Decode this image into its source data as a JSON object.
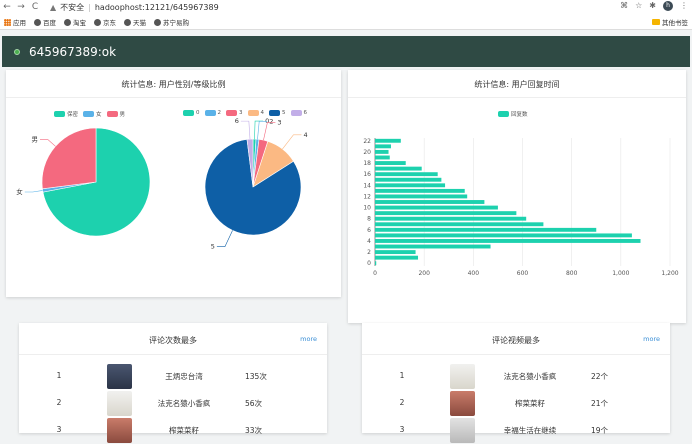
{
  "browser": {
    "url_warning": "不安全",
    "url": "hadoophost:12121/645967389",
    "avatar": "h",
    "bookmarks": [
      "应用",
      "百度",
      "淘宝",
      "京东",
      "天猫",
      "苏宁易购"
    ],
    "other_bookmarks": "其他书签"
  },
  "header": {
    "title": "645967389:ok",
    "accent": "#2f4a44"
  },
  "card1": {
    "title": "统计信息: 用户性别/等级比例",
    "gender_legend": [
      {
        "label": "保密",
        "color": "#1dd1ae"
      },
      {
        "label": "女",
        "color": "#5ab2e8"
      },
      {
        "label": "男",
        "color": "#f4697f"
      }
    ],
    "level_legend": [
      {
        "label": "0",
        "color": "#1dd1ae"
      },
      {
        "label": "2",
        "color": "#5ab2e8"
      },
      {
        "label": "3",
        "color": "#f4697f"
      },
      {
        "label": "4",
        "color": "#fbb983"
      },
      {
        "label": "5",
        "color": "#0e5fa6"
      },
      {
        "label": "6",
        "color": "#c2aee8"
      }
    ]
  },
  "card2": {
    "title": "统计信息: 用户回复时间",
    "legend": "回复数"
  },
  "chart_data": [
    {
      "type": "pie",
      "labels": [
        "保密",
        "女",
        "男"
      ],
      "values": [
        72,
        1,
        27
      ],
      "colors": [
        "#1dd1ae",
        "#5ab2e8",
        "#f4697f"
      ],
      "slice_labels": [
        "",
        "女",
        "男"
      ]
    },
    {
      "type": "pie",
      "labels": [
        "0",
        "2",
        "3",
        "4",
        "5",
        "6"
      ],
      "values": [
        1,
        1,
        3,
        11,
        82,
        2
      ],
      "colors": [
        "#1dd1ae",
        "#5ab2e8",
        "#f4697f",
        "#fbb983",
        "#0e5fa6",
        "#c2aee8"
      ],
      "slice_labels": [
        "0",
        "2",
        "3",
        "4",
        "5",
        "6"
      ]
    },
    {
      "type": "bar",
      "orientation": "horizontal",
      "series": [
        {
          "name": "回复数",
          "color": "#1dd1ae",
          "values": [
            5,
            175,
            165,
            470,
            1080,
            1045,
            900,
            685,
            615,
            575,
            500,
            445,
            375,
            365,
            285,
            270,
            255,
            190,
            125,
            60,
            55,
            65,
            105
          ]
        }
      ],
      "categories": [
        "0",
        "1",
        "2",
        "3",
        "4",
        "5",
        "6",
        "7",
        "8",
        "9",
        "10",
        "11",
        "12",
        "13",
        "14",
        "15",
        "16",
        "17",
        "18",
        "19",
        "20",
        "21",
        "22"
      ],
      "y_tick_labels": [
        "0",
        "2",
        "4",
        "6",
        "8",
        "10",
        "12",
        "14",
        "16",
        "18",
        "20",
        "22"
      ],
      "x_tick_labels": [
        "0",
        "200",
        "400",
        "600",
        "800",
        "1,000",
        "1,200"
      ],
      "xlim": [
        0,
        1200
      ],
      "grid": true
    }
  ],
  "table1": {
    "title": "评论次数最多",
    "more": "more",
    "rows": [
      {
        "rank": "1",
        "name": "王炳忠台湾",
        "count": "135次"
      },
      {
        "rank": "2",
        "name": "法克名猿小香疯",
        "count": "56次"
      },
      {
        "rank": "3",
        "name": "榨菜菜籽",
        "count": "33次"
      }
    ]
  },
  "table2": {
    "title": "评论视频最多",
    "more": "more",
    "rows": [
      {
        "rank": "1",
        "name": "法克名猿小香疯",
        "count": "22个"
      },
      {
        "rank": "2",
        "name": "榨菜菜籽",
        "count": "21个"
      },
      {
        "rank": "3",
        "name": "幸福生活在继续",
        "count": "19个"
      }
    ]
  }
}
